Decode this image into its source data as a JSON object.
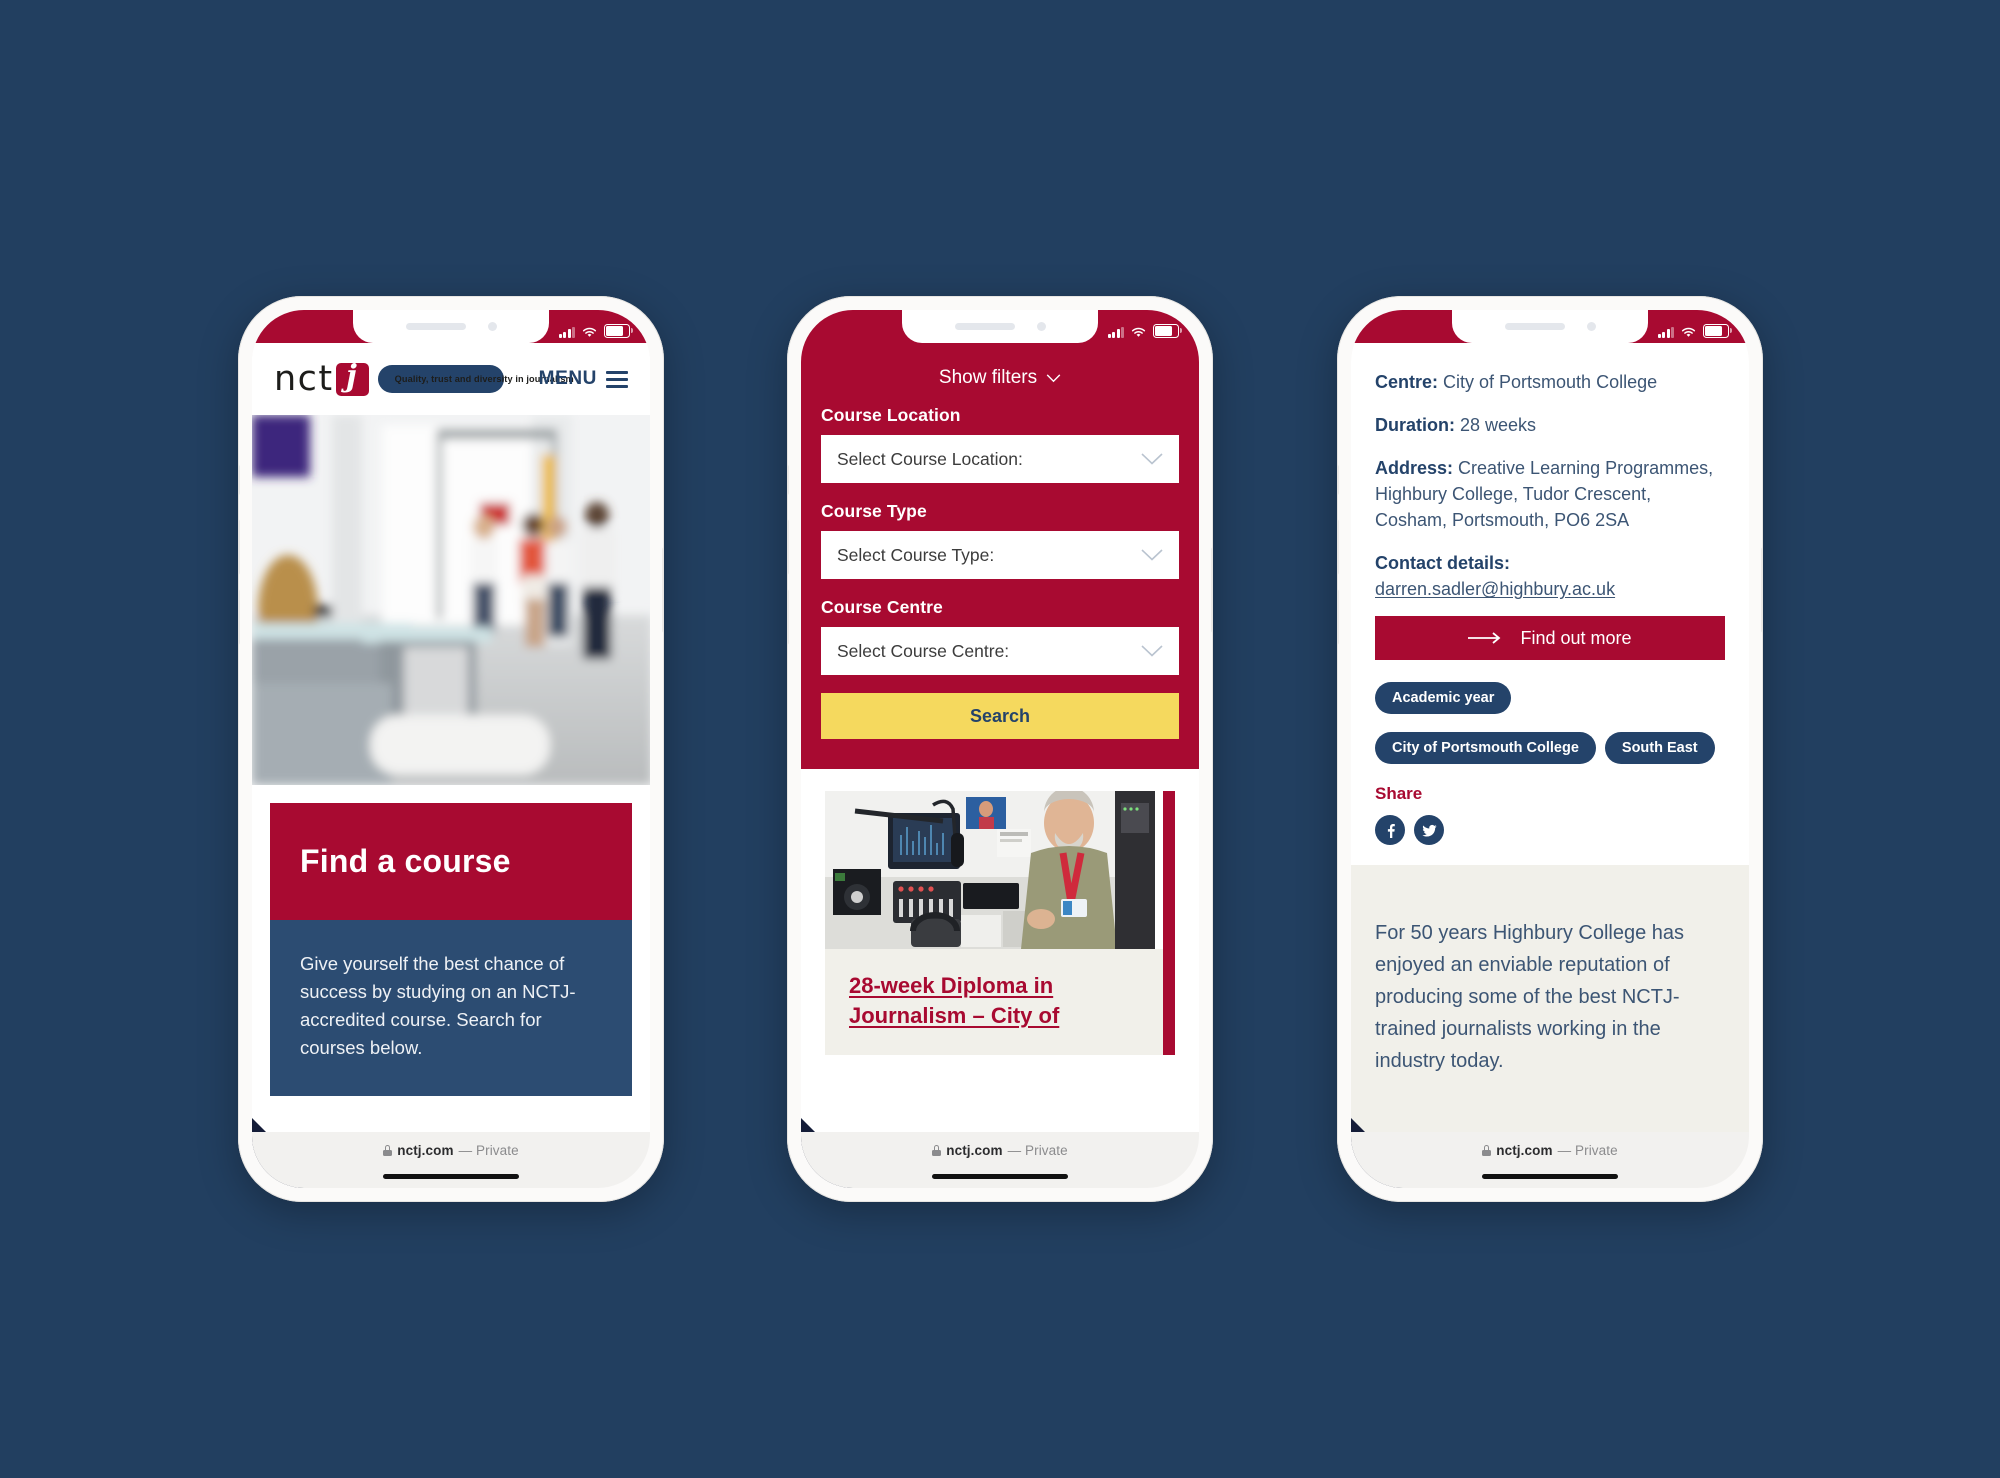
{
  "background_color": "#223f60",
  "brand": {
    "red": "#a80a31",
    "navy": "#24436a",
    "dark_navy": "#141c38",
    "yellow": "#f5d95e",
    "cream": "#f1f0ea"
  },
  "browser": {
    "url_domain": "nctj.com",
    "privacy_label": "— Private",
    "lock_icon": "lock-icon"
  },
  "status_bar": {
    "signal_icon": "cellular-signal-icon",
    "wifi_icon": "wifi-icon",
    "battery_icon": "battery-icon"
  },
  "phone1": {
    "header": {
      "logo_word": "nct",
      "logo_j": "j",
      "logo_tagline": "Quality, trust and diversity in journalism",
      "menu_label": "MENU",
      "menu_icon": "hamburger-menu-icon"
    },
    "hero_image_alt": "college-reception-photo",
    "card": {
      "title": "Find a course",
      "body": "Give yourself the best chance of success by studying on an NCTJ-accredited course. Search for courses below."
    },
    "cookie_icon": "cookie-settings-gear-icon"
  },
  "phone2": {
    "show_filters_label": "Show filters",
    "show_filters_icon": "chevron-down-icon",
    "fields": [
      {
        "label": "Course Location",
        "placeholder": "Select Course Location:",
        "icon": "chevron-down-icon"
      },
      {
        "label": "Course Type",
        "placeholder": "Select Course Type:",
        "icon": "chevron-down-icon"
      },
      {
        "label": "Course Centre",
        "placeholder": "Select Course Centre:",
        "icon": "chevron-down-icon"
      }
    ],
    "search_button": "Search",
    "result": {
      "image_alt": "radio-studio-tutor-photo",
      "title": "28-week Diploma in Journalism – City of"
    },
    "cookie_icon": "cookie-settings-gear-icon"
  },
  "phone3": {
    "details": [
      {
        "label": "Centre:",
        "value": " City of Portsmouth College"
      },
      {
        "label": "Duration:",
        "value": " 28 weeks"
      },
      {
        "label": "Address:",
        "value": " Creative Learning Programmes, Highbury College, Tudor Crescent, Cosham, Portsmouth, PO6 2SA"
      },
      {
        "label": "Contact details:",
        "value": ""
      }
    ],
    "contact_email": "darren.sadler@highbury.ac.uk",
    "find_out_more": "Find out more",
    "find_out_more_icon": "arrow-right-icon",
    "tags": [
      "Academic year",
      "City of Portsmouth College",
      "South East"
    ],
    "share_label": "Share",
    "share_icons": [
      {
        "name": "facebook-icon",
        "glyph": "f"
      },
      {
        "name": "twitter-icon",
        "glyph": "bird"
      }
    ],
    "about_text": "For 50 years Highbury College has enjoyed an enviable reputation of producing some of the best NCTJ-trained journalists working in the industry today.",
    "cookie_icon": "cookie-settings-gear-icon"
  }
}
